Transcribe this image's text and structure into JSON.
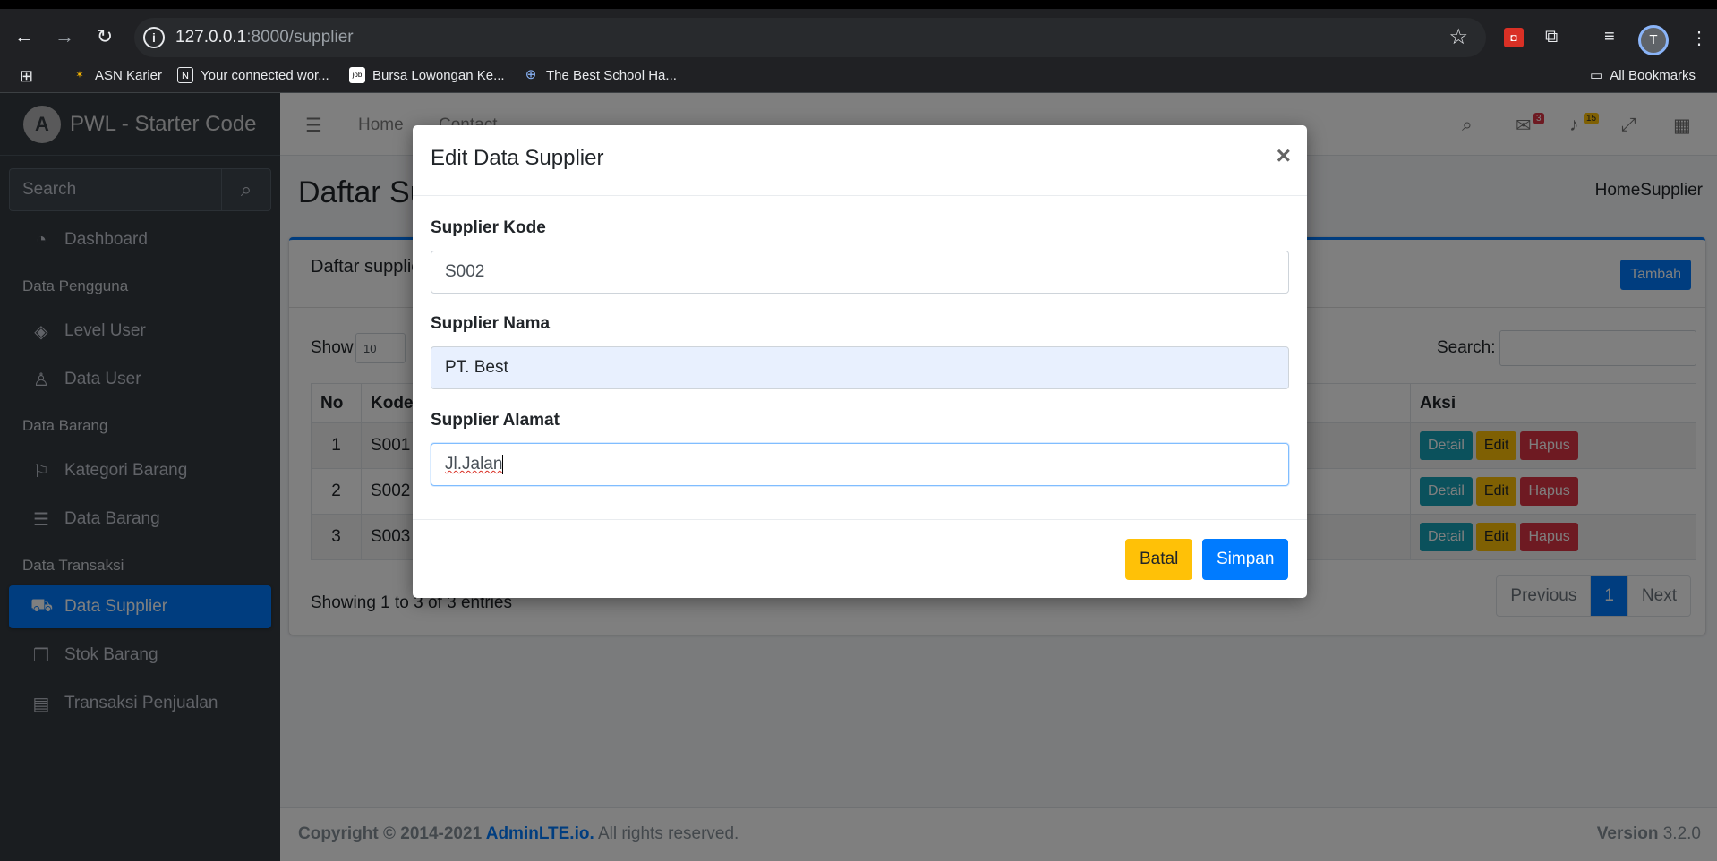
{
  "browser": {
    "url_host": "127.0.0.1",
    "url_rest": ":8000/supplier",
    "bookmarks": [
      {
        "label": "ASN Karier",
        "icon": "asn-icon"
      },
      {
        "label": "Your connected wor...",
        "icon": "notion-icon"
      },
      {
        "label": "Bursa Lowongan Ke...",
        "icon": "jobs-icon"
      },
      {
        "label": "The Best School Ha...",
        "icon": "globe-icon"
      }
    ],
    "all_bookmarks": "All Bookmarks",
    "profile_initial": "T"
  },
  "sidebar": {
    "brand": "PWL - Starter Code",
    "brand_logo": "A",
    "search_placeholder": "Search",
    "items": [
      {
        "label": "Dashboard",
        "icon": "tachometer-icon"
      },
      {
        "header": "Data Pengguna"
      },
      {
        "label": "Level User",
        "icon": "layers-icon"
      },
      {
        "label": "Data User",
        "icon": "user-icon"
      },
      {
        "header": "Data Barang"
      },
      {
        "label": "Kategori Barang",
        "icon": "bookmark-icon"
      },
      {
        "label": "Data Barang",
        "icon": "list-icon"
      },
      {
        "header": "Data Transaksi"
      },
      {
        "label": "Data Supplier",
        "icon": "truck-icon",
        "active": true
      },
      {
        "label": "Stok Barang",
        "icon": "cubes-icon"
      },
      {
        "label": "Transaksi Penjualan",
        "icon": "cash-register-icon"
      }
    ]
  },
  "topnav": {
    "home": "Home",
    "contact": "Contact",
    "messages_badge": "3",
    "notifications_badge": "15"
  },
  "content": {
    "title": "Daftar Supplier",
    "breadcrumb": "HomeSupplier",
    "card_title": "Daftar supplier",
    "tambah": "Tambah",
    "show_label": "Show",
    "show_value": "10",
    "search_label": "Search:",
    "columns": [
      "No",
      "Kode",
      "Aksi"
    ],
    "rows": [
      {
        "no": "1",
        "kode": "S001"
      },
      {
        "no": "2",
        "kode": "S002"
      },
      {
        "no": "3",
        "kode": "S003"
      }
    ],
    "actions": {
      "detail": "Detail",
      "edit": "Edit",
      "hapus": "Hapus"
    },
    "showing": "Showing 1 to 3 of 3 entries",
    "pager": {
      "prev": "Previous",
      "current": "1",
      "next": "Next"
    }
  },
  "footer": {
    "copy_prefix": "Copyright © 2014-2021 ",
    "copy_link": "AdminLTE.io.",
    "copy_suffix": " All rights reserved.",
    "version_label": "Version",
    "version_value": " 3.2.0"
  },
  "modal": {
    "title": "Edit Data Supplier",
    "close": "×",
    "fields": [
      {
        "label": "Supplier Kode",
        "value": "S002"
      },
      {
        "label": "Supplier Nama",
        "value": "PT. Best"
      },
      {
        "label": "Supplier Alamat",
        "value": "Jl.Jalan"
      }
    ],
    "batal": "Batal",
    "simpan": "Simpan"
  },
  "colors": {
    "primary": "#007bff",
    "warning": "#ffc107",
    "danger": "#dc3545",
    "info": "#17a2b8",
    "sidebar": "#343a40"
  }
}
